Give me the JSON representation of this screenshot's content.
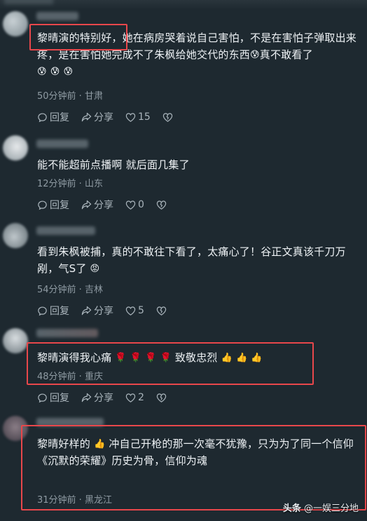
{
  "comments": [
    {
      "text_parts": [
        "黎晴演的特别好",
        "，她在病房哭着说自己害怕，不是在害怕子弹取出来疼，是在害怕她完成不了朱枫给她交代的东西",
        "😰",
        "真不敢看了",
        "😰",
        "😰",
        "😰"
      ],
      "time": "50分钟前",
      "location": "甘肃",
      "reply_label": "回复",
      "share_label": "分享",
      "likes": "15"
    },
    {
      "text": "能不能超前点播啊 就后面几集了",
      "time": "12分钟前",
      "location": "山东",
      "reply_label": "回复",
      "share_label": "分享",
      "likes": "0"
    },
    {
      "text_parts": [
        "看到朱枫被捕，真的不敢往下看了，太痛心了！谷正文真该千刀万剐，气S了",
        "😡"
      ],
      "time": "54分钟前",
      "location": "吉林",
      "reply_label": "回复",
      "share_label": "分享",
      "likes": "5"
    },
    {
      "text_parts": [
        "黎晴演得我心痛",
        "🌹",
        "🌹",
        "🌹",
        "🌹",
        "致敬忠烈",
        "👍",
        "👍",
        "👍"
      ],
      "time": "48分钟前",
      "location": "重庆",
      "reply_label": "回复",
      "share_label": "分享",
      "likes": "2"
    },
    {
      "text_parts": [
        "黎晴好样的",
        "👍",
        "冲自己开枪的那一次毫不犹豫，只为为了同一个信仰",
        "《沉默的荣耀》历史为骨，信仰为魂"
      ],
      "time": "31分钟前",
      "location": "黑龙江"
    }
  ],
  "watermark": {
    "brand": "头条",
    "handle": "@一娱三分地"
  },
  "colors": {
    "highlight": "#e8474b",
    "background": "#1e2930"
  }
}
